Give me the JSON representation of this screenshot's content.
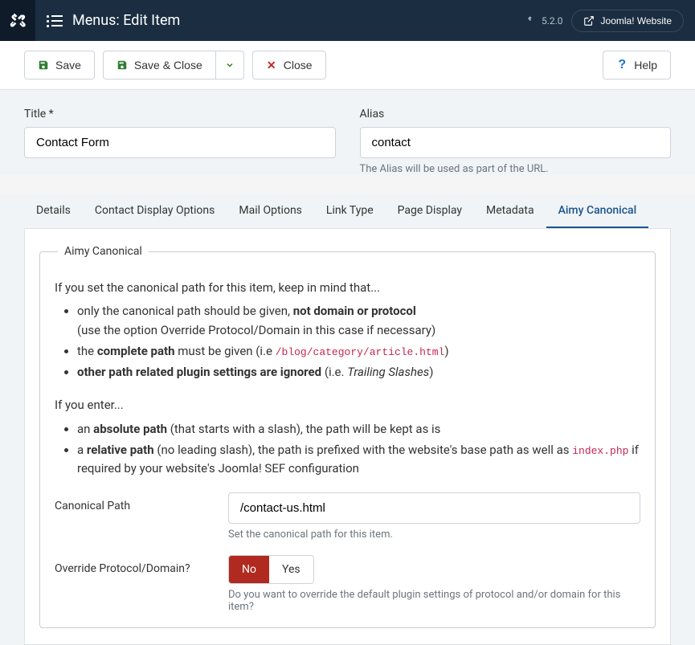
{
  "header": {
    "page_title": "Menus: Edit Item",
    "version": "5.2.0",
    "external_label": "Joomla! Website"
  },
  "toolbar": {
    "save": "Save",
    "save_close": "Save & Close",
    "close": "Close",
    "help": "Help"
  },
  "fields": {
    "title_label": "Title *",
    "title_value": "Contact Form",
    "alias_label": "Alias",
    "alias_value": "contact",
    "alias_hint": "The Alias will be used as part of the URL."
  },
  "tabs": [
    {
      "label": "Details"
    },
    {
      "label": "Contact Display Options"
    },
    {
      "label": "Mail Options"
    },
    {
      "label": "Link Type"
    },
    {
      "label": "Page Display"
    },
    {
      "label": "Metadata"
    },
    {
      "label": "Aimy Canonical"
    }
  ],
  "panel": {
    "legend": "Aimy Canonical",
    "intro1": "If you set the canonical path for this item, keep in mind that...",
    "b1_pre": "only the canonical path should be given, ",
    "b1_bold": "not domain or protocol",
    "b1_sub": "(use the option Override Protocol/Domain in this case if necessary)",
    "b2_pre": "the ",
    "b2_bold": "complete path",
    "b2_mid": " must be given (i.e ",
    "b2_code": "/blog/category/article.html",
    "b2_end": ")",
    "b3_bold": "other path related plugin settings are ignored",
    "b3_mid": " (i.e. ",
    "b3_em": "Trailing Slashes",
    "b3_end": ")",
    "intro2": "If you enter...",
    "b4_pre": "an ",
    "b4_bold": "absolute path",
    "b4_end": " (that starts with a slash), the path will be kept as is",
    "b5_pre": "a ",
    "b5_bold": "relative path",
    "b5_mid": " (no leading slash), the path is prefixed with the website's base path as well as ",
    "b5_code": "index.php",
    "b5_end": " if required by your website's Joomla! SEF configuration",
    "canonical_label": "Canonical Path",
    "canonical_value": "/contact-us.html",
    "canonical_hint": "Set the canonical path for this item.",
    "override_label": "Override Protocol/Domain?",
    "override_no": "No",
    "override_yes": "Yes",
    "override_hint": "Do you want to override the default plugin settings of protocol and/or domain for this item?"
  }
}
